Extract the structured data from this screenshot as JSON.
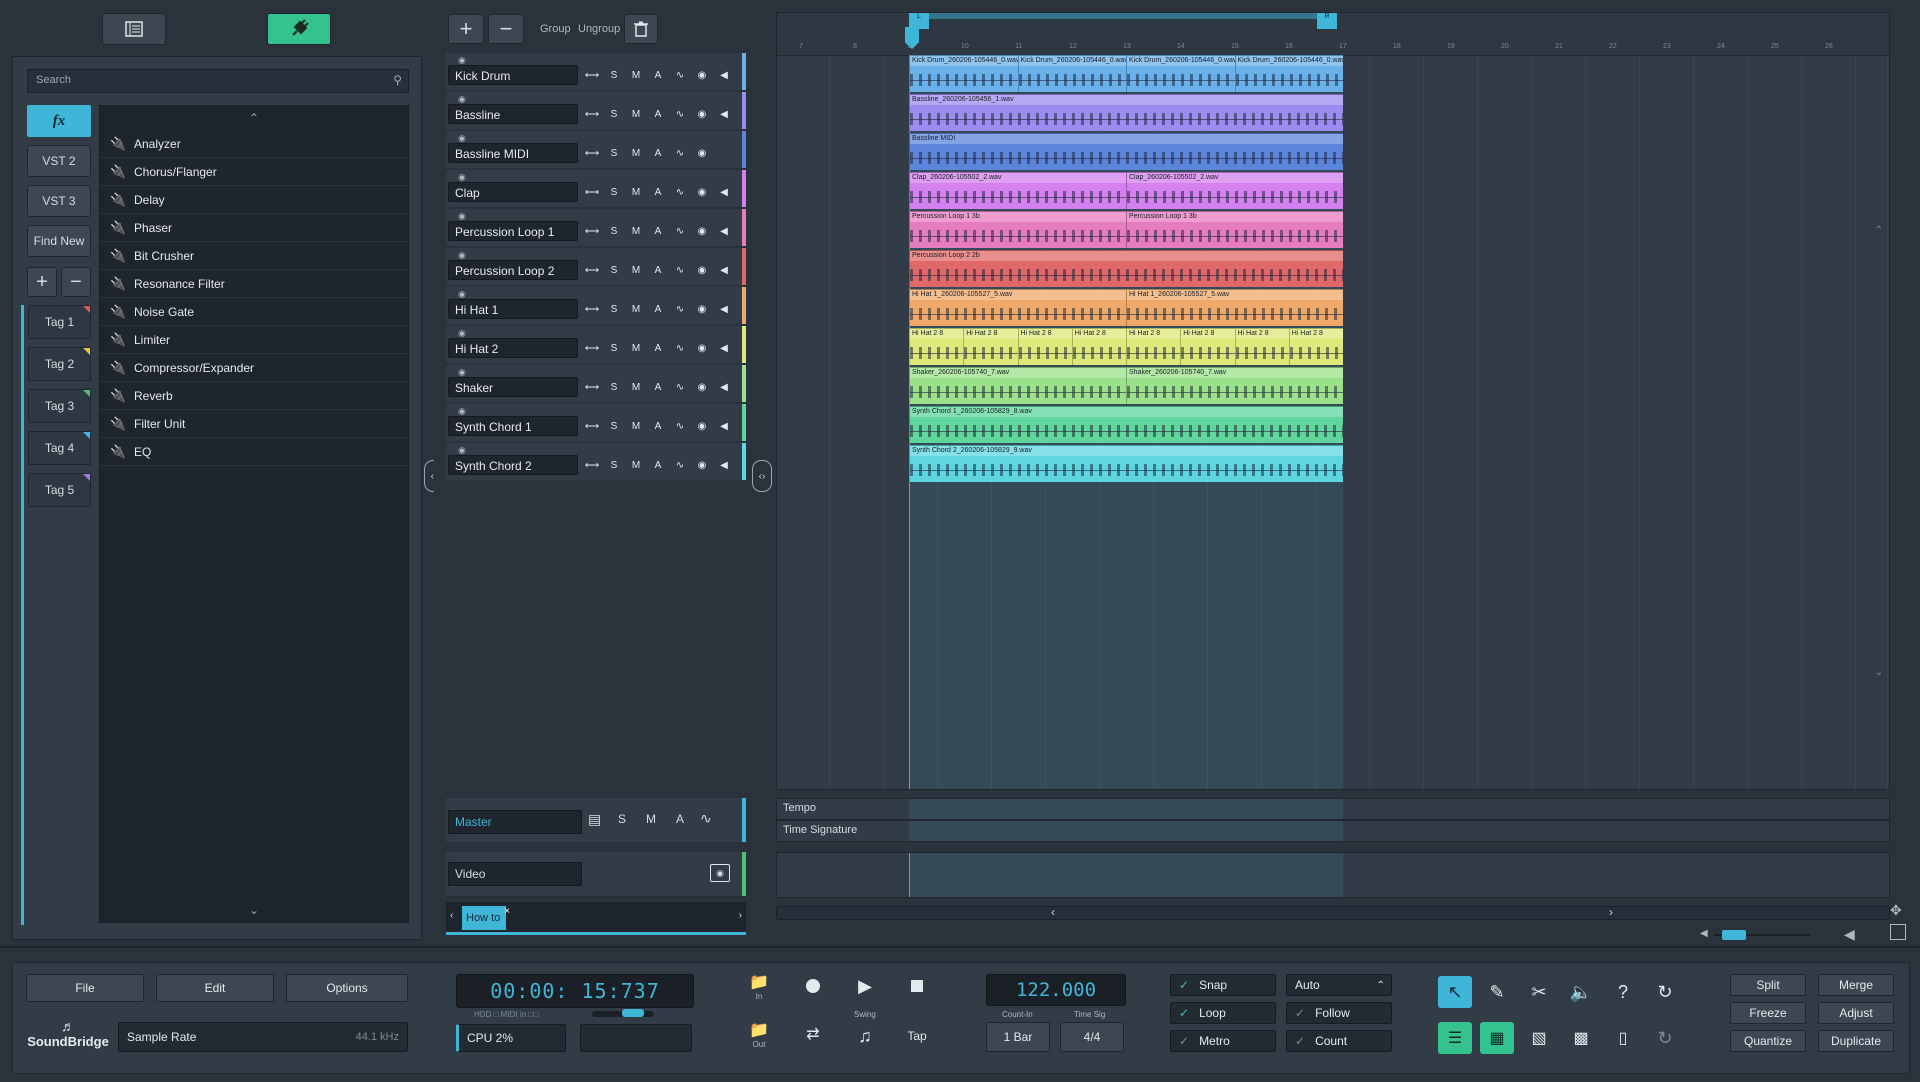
{
  "colors": {
    "accent": "#3fb6d8",
    "accent_green": "#34c38f",
    "panel": "#323c46",
    "background": "#2a333c"
  },
  "left_panel": {
    "top_buttons": [
      {
        "icon": "browser-icon"
      },
      {
        "icon": "plugin-plug-icon"
      }
    ],
    "search_placeholder": "Search",
    "fx_tab": "fx",
    "side_buttons": [
      "VST 2",
      "VST 3",
      "Find New"
    ],
    "tags": [
      {
        "label": "Tag 1",
        "color": "#e45a5a"
      },
      {
        "label": "Tag 2",
        "color": "#e6c640"
      },
      {
        "label": "Tag 3",
        "color": "#4fc07a"
      },
      {
        "label": "Tag 4",
        "color": "#46b7dc"
      },
      {
        "label": "Tag 5",
        "color": "#a07ce0"
      }
    ],
    "effects": [
      "Analyzer",
      "Chorus/Flanger",
      "Delay",
      "Phaser",
      "Bit Crusher",
      "Resonance Filter",
      "Noise Gate",
      "Limiter",
      "Compressor/Expander",
      "Reverb",
      "Filter Unit",
      "EQ"
    ]
  },
  "track_toolbar": {
    "group": "Group",
    "ungroup": "Ungroup"
  },
  "tracks": [
    {
      "name": "Kick Drum",
      "color": "#6ab0ea"
    },
    {
      "name": "Bassline",
      "color": "#9d8cf0"
    },
    {
      "name": "Bassline MIDI",
      "color": "#5b86dc"
    },
    {
      "name": "Clap",
      "color": "#d480ee"
    },
    {
      "name": "Percussion Loop 1",
      "color": "#e77dbf"
    },
    {
      "name": "Percussion Loop 2",
      "color": "#e06868"
    },
    {
      "name": "Hi Hat 1",
      "color": "#f0a868"
    },
    {
      "name": "Hi Hat 2",
      "color": "#dde878"
    },
    {
      "name": "Shaker",
      "color": "#9be08a"
    },
    {
      "name": "Synth Chord 1",
      "color": "#5ed69c"
    },
    {
      "name": "Synth Chord 2",
      "color": "#5ed6e0"
    }
  ],
  "track_buttons": {
    "s": "S",
    "m": "M",
    "a": "A"
  },
  "master": {
    "name": "Master",
    "s": "S",
    "m": "M",
    "a": "A"
  },
  "video": {
    "name": "Video"
  },
  "howto_tab": "How to",
  "ruler": {
    "numbers": [
      "7",
      "8",
      "9",
      "10",
      "11",
      "12",
      "13",
      "14",
      "15",
      "16",
      "17",
      "18",
      "19",
      "20",
      "21",
      "22",
      "23",
      "24",
      "25",
      "26"
    ],
    "loop_start": "L",
    "loop_end": "R"
  },
  "clips": [
    {
      "lane": 0,
      "names": [
        "Kick Drum_260206-105446_0.wav",
        "Kick Drum_260206-105446_0.wav",
        "Kick Drum_260206-105446_0.wav",
        "Kick Drum_260206-105446_0.wav"
      ]
    },
    {
      "lane": 1,
      "names": [
        "Bassline_260206-105456_1.wav"
      ]
    },
    {
      "lane": 2,
      "names": [
        "Bassline MIDI"
      ]
    },
    {
      "lane": 3,
      "names": [
        "Clap_260206-105502_2.wav",
        "Clap_260206-105502_2.wav"
      ]
    },
    {
      "lane": 4,
      "names": [
        "Percussion Loop 1 3b",
        "Percussion Loop 1 3b"
      ]
    },
    {
      "lane": 5,
      "names": [
        "Percussion Loop 2 2b"
      ]
    },
    {
      "lane": 6,
      "names": [
        "Hi Hat 1_260206-105527_5.wav",
        "Hi Hat 1_260206-105527_5.wav"
      ]
    },
    {
      "lane": 7,
      "names": [
        "Hi Hat 2 8",
        "Hi Hat 2 8",
        "Hi Hat 2 8",
        "Hi Hat 2 8",
        "Hi Hat 2 8",
        "Hi Hat 2 8",
        "Hi Hat 2 8",
        "Hi Hat 2 8"
      ]
    },
    {
      "lane": 8,
      "names": [
        "Shaker_260206-105740_7.wav",
        "Shaker_260206-105740_7.wav"
      ]
    },
    {
      "lane": 9,
      "names": [
        "Synth Chord 1_260206-105829_8.wav"
      ]
    },
    {
      "lane": 10,
      "names": [
        "Synth Chord 2_260206-105829_9.wav"
      ]
    }
  ],
  "automation": {
    "tempo": "Tempo",
    "time_signature": "Time Signature"
  },
  "transport": {
    "file": "File",
    "edit": "Edit",
    "options": "Options",
    "logo": "SoundBridge",
    "sample_rate_label": "Sample Rate",
    "sample_rate_value": "44.1 kHz",
    "time": "00:00: 15:737",
    "hdd_label": "HDD",
    "midi_in_label": "MIDI In",
    "cpu": "CPU 2%",
    "in_label": "In",
    "out_label": "Out",
    "swing_label": "Swing",
    "tap": "Tap",
    "tempo": "122.000",
    "count_in_label": "Count-In",
    "time_sig_label": "Time Sig",
    "count_in_value": "1 Bar",
    "time_sig_value": "4/4",
    "snap": "Snap",
    "loop": "Loop",
    "metro": "Metro",
    "auto": "Auto",
    "follow": "Follow",
    "count": "Count",
    "split": "Split",
    "merge": "Merge",
    "freeze": "Freeze",
    "adjust": "Adjust",
    "quantize": "Quantize",
    "duplicate": "Duplicate",
    "tools": [
      "select-arrow-icon",
      "pencil-icon",
      "scissors-icon",
      "mute-speaker-icon",
      "help-question-icon",
      "undo-circular-icon"
    ],
    "views": [
      "tracks-view-icon",
      "mixer-view-icon",
      "waveform-editor-icon",
      "piano-roll-icon",
      "device-icon",
      "redo-circular-icon"
    ]
  }
}
